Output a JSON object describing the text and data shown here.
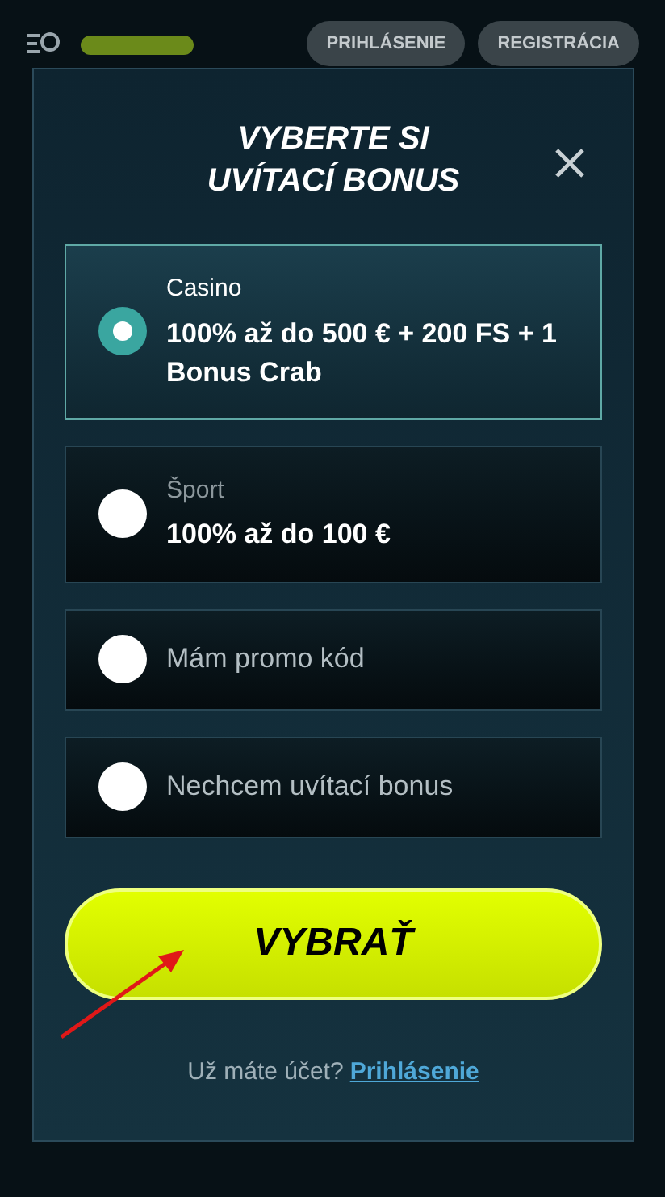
{
  "header": {
    "buttons": [
      "PRIHLÁSENIE",
      "REGISTRÁCIA"
    ]
  },
  "modal": {
    "title_lines": [
      "VYBERTE SI",
      "UVÍTACÍ BONUS"
    ],
    "options": [
      {
        "kind": "bonus",
        "category": "Casino",
        "offer": "100% až do 500 € + 200 FS + 1 Bonus Crab",
        "selected": true
      },
      {
        "kind": "bonus",
        "category": "Šport",
        "offer": "100% až do 100 €",
        "selected": false
      },
      {
        "kind": "plain",
        "label": "Mám promo kód",
        "selected": false
      },
      {
        "kind": "plain",
        "label": "Nechcem uvítací bonus",
        "selected": false
      }
    ],
    "submit": "VYBRAŤ",
    "footer": {
      "question": "Už máte účet?",
      "link": "Prihlásenie"
    }
  }
}
